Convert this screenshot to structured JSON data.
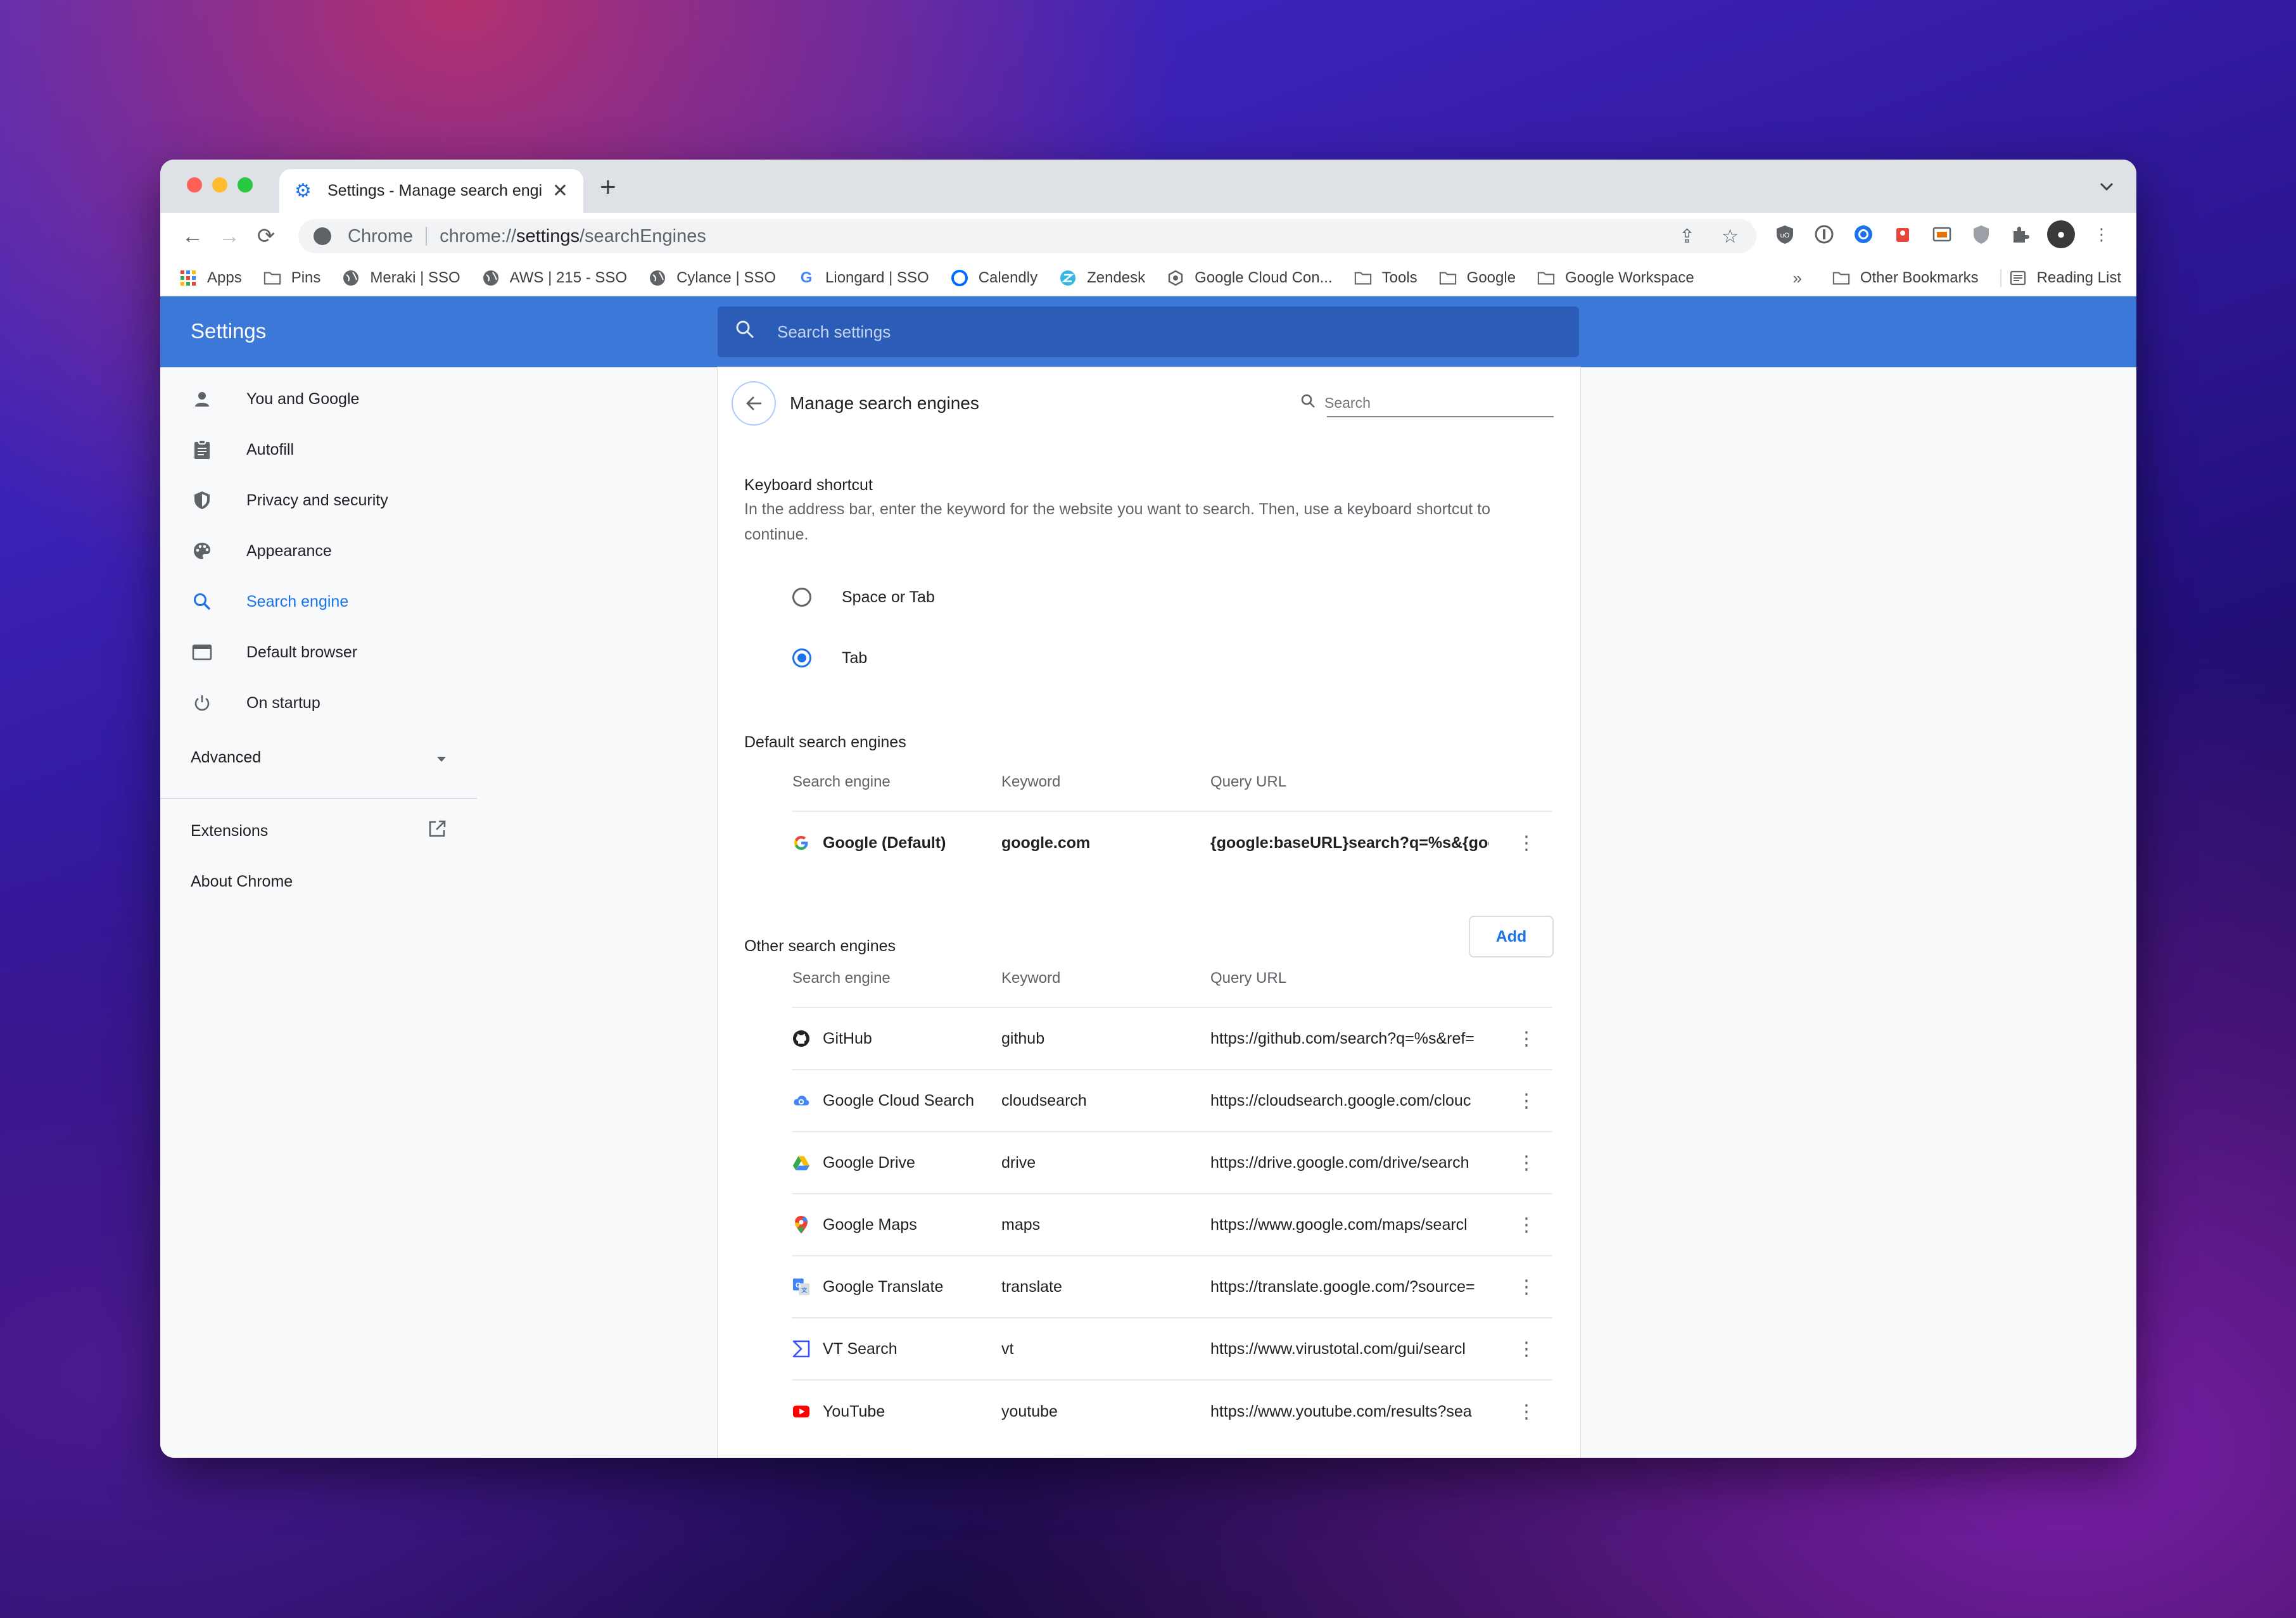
{
  "tab": {
    "title": "Settings - Manage search engines",
    "close": "✕",
    "new_tab": "+",
    "menu": "⌄"
  },
  "toolbar": {
    "back": "←",
    "forward": "→",
    "reload": "⟳",
    "chip": "Chrome",
    "url_prefix": "chrome://",
    "url_host": "settings",
    "url_path": "/searchEngines",
    "share": "⇪",
    "star": "☆",
    "extensions": [
      "ublock-icon",
      "1password-icon",
      "blue-circle-icon",
      "red-extension-icon",
      "cast-icon",
      "shield-icon",
      "puzzle-icon"
    ],
    "menu": "⋮"
  },
  "bookmarks": {
    "items": [
      {
        "label": "Apps",
        "icon": "apps-grid-icon"
      },
      {
        "label": "Pins",
        "icon": "folder-icon"
      },
      {
        "label": "Meraki | SSO",
        "icon": "globe-icon"
      },
      {
        "label": "AWS | 215 - SSO",
        "icon": "globe-icon"
      },
      {
        "label": "Cylance | SSO",
        "icon": "globe-icon"
      },
      {
        "label": "Liongard | SSO",
        "icon": "google-icon"
      },
      {
        "label": "Calendly",
        "icon": "calendly-icon"
      },
      {
        "label": "Zendesk",
        "icon": "zendesk-icon"
      },
      {
        "label": "Google Cloud Con...",
        "icon": "gcp-icon"
      },
      {
        "label": "Tools",
        "icon": "folder-icon"
      },
      {
        "label": "Google",
        "icon": "folder-icon"
      },
      {
        "label": "Google Workspace",
        "icon": "folder-icon"
      }
    ],
    "more": "»",
    "other": "Other Bookmarks",
    "reading_list": "Reading List"
  },
  "header": {
    "title": "Settings",
    "search_placeholder": "Search settings"
  },
  "sidebar": {
    "items": [
      {
        "label": "You and Google",
        "icon": "person-icon"
      },
      {
        "label": "Autofill",
        "icon": "clipboard-icon"
      },
      {
        "label": "Privacy and security",
        "icon": "shield-icon"
      },
      {
        "label": "Appearance",
        "icon": "palette-icon"
      },
      {
        "label": "Search engine",
        "icon": "search-icon",
        "active": true
      },
      {
        "label": "Default browser",
        "icon": "browser-icon"
      },
      {
        "label": "On startup",
        "icon": "power-icon"
      }
    ],
    "advanced": "Advanced",
    "extensions": "Extensions",
    "about": "About Chrome"
  },
  "page": {
    "title": "Manage search engines",
    "search_placeholder": "Search",
    "shortcut": {
      "title": "Keyboard shortcut",
      "description": "In the address bar, enter the keyword for the website you want to search. Then, use a keyboard shortcut to continue.",
      "options": [
        {
          "label": "Space or Tab",
          "selected": false
        },
        {
          "label": "Tab",
          "selected": true
        }
      ]
    },
    "default_engines": {
      "title": "Default search engines",
      "headers": [
        "Search engine",
        "Keyword",
        "Query URL"
      ],
      "rows": [
        {
          "name": "Google (Default)",
          "keyword": "google.com",
          "url": "{google:baseURL}search?q=%s&{goog",
          "icon": "google-icon",
          "bold": true
        }
      ]
    },
    "other_engines": {
      "title": "Other search engines",
      "add_label": "Add",
      "headers": [
        "Search engine",
        "Keyword",
        "Query URL"
      ],
      "rows": [
        {
          "name": "GitHub",
          "keyword": "github",
          "url": "https://github.com/search?q=%s&ref=",
          "icon": "github-icon"
        },
        {
          "name": "Google Cloud Search",
          "keyword": "cloudsearch",
          "url": "https://cloudsearch.google.com/clouc",
          "icon": "cloud-search-icon"
        },
        {
          "name": "Google Drive",
          "keyword": "drive",
          "url": "https://drive.google.com/drive/search",
          "icon": "drive-icon"
        },
        {
          "name": "Google Maps",
          "keyword": "maps",
          "url": "https://www.google.com/maps/searcl",
          "icon": "maps-pin-icon"
        },
        {
          "name": "Google Translate",
          "keyword": "translate",
          "url": "https://translate.google.com/?source=",
          "icon": "translate-icon"
        },
        {
          "name": "VT Search",
          "keyword": "vt",
          "url": "https://www.virustotal.com/gui/searcl",
          "icon": "virustotal-icon"
        },
        {
          "name": "YouTube",
          "keyword": "youtube",
          "url": "https://www.youtube.com/results?sea",
          "icon": "youtube-icon"
        }
      ]
    }
  },
  "colors": {
    "accent": "#1a73e8",
    "header_bg": "#3c78d8"
  }
}
